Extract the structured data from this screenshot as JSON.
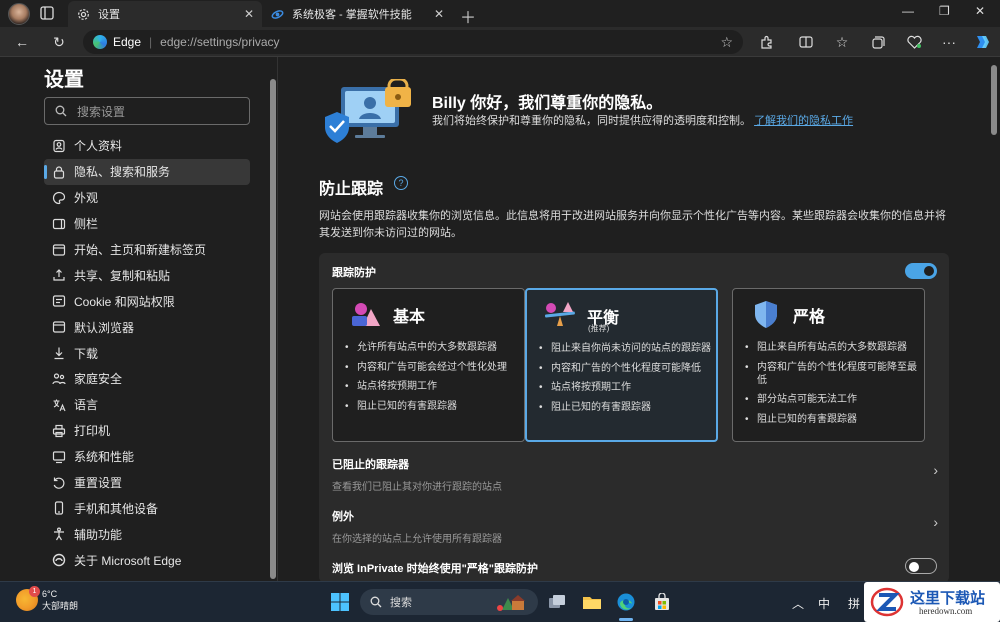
{
  "browser": {
    "tabs": [
      {
        "title": "设置",
        "icon": "gear-icon"
      },
      {
        "title": "系统极客 - 掌握软件技能",
        "icon": "site-favicon-icon"
      }
    ],
    "address": {
      "site_label": "Edge",
      "url": "edge://settings/privacy"
    }
  },
  "sidebar": {
    "title": "设置",
    "search_placeholder": "搜索设置",
    "items": [
      {
        "label": "个人资料",
        "icon": "profile-icon"
      },
      {
        "label": "隐私、搜索和服务",
        "icon": "lock-icon",
        "active": true
      },
      {
        "label": "外观",
        "icon": "appearance-icon"
      },
      {
        "label": "侧栏",
        "icon": "sidebar-icon"
      },
      {
        "label": "开始、主页和新建标签页",
        "icon": "home-icon"
      },
      {
        "label": "共享、复制和粘贴",
        "icon": "share-icon"
      },
      {
        "label": "Cookie 和网站权限",
        "icon": "cookie-icon"
      },
      {
        "label": "默认浏览器",
        "icon": "browser-icon"
      },
      {
        "label": "下载",
        "icon": "download-icon"
      },
      {
        "label": "家庭安全",
        "icon": "family-icon"
      },
      {
        "label": "语言",
        "icon": "language-icon"
      },
      {
        "label": "打印机",
        "icon": "printer-icon"
      },
      {
        "label": "系统和性能",
        "icon": "system-icon"
      },
      {
        "label": "重置设置",
        "icon": "reset-icon"
      },
      {
        "label": "手机和其他设备",
        "icon": "phone-icon"
      },
      {
        "label": "辅助功能",
        "icon": "accessibility-icon"
      },
      {
        "label": "关于 Microsoft Edge",
        "icon": "edge-icon"
      }
    ]
  },
  "main": {
    "hero_title": "Billy 你好，我们尊重你的隐私。",
    "hero_sub": "我们将始终保护和尊重你的隐私，同时提供应得的透明度和控制。",
    "hero_link": "了解我们的隐私工作",
    "section_title": "防止跟踪",
    "section_desc": "网站会使用跟踪器收集你的浏览信息。此信息将用于改进网站服务并向你显示个性化广告等内容。某些跟踪器会收集你的信息并将其发送到你未访问过的网站。",
    "tracking_label": "跟踪防护",
    "tracking_on": true,
    "cards": [
      {
        "title": "基本",
        "subtitle": "",
        "selected": false,
        "items": [
          "允许所有站点中的大多数跟踪器",
          "内容和广告可能会经过个性化处理",
          "站点将按预期工作",
          "阻止已知的有害跟踪器"
        ]
      },
      {
        "title": "平衡",
        "subtitle": "(推荐)",
        "selected": true,
        "items": [
          "阻止来自你尚未访问的站点的跟踪器",
          "内容和广告的个性化程度可能降低",
          "站点将按预期工作",
          "阻止已知的有害跟踪器"
        ]
      },
      {
        "title": "严格",
        "subtitle": "",
        "selected": false,
        "items": [
          "阻止来自所有站点的大多数跟踪器",
          "内容和广告的个性化程度可能降至最低",
          "部分站点可能无法工作",
          "阻止已知的有害跟踪器"
        ]
      }
    ],
    "blocked_title": "已阻止的跟踪器",
    "blocked_sub": "查看我们已阻止其对你进行跟踪的站点",
    "exceptions_title": "例外",
    "exceptions_sub": "在你选择的站点上允许使用所有跟踪器",
    "inprivate_label": "浏览 InPrivate 时始终使用\"严格\"跟踪防护",
    "inprivate_on": false
  },
  "taskbar": {
    "weather_temp": "6°C",
    "weather_desc": "大部晴朗",
    "weather_badge": "1",
    "search_label": "搜索",
    "ime1": "中",
    "ime2": "拼"
  },
  "watermark": {
    "line1": "这里下载站",
    "line2": "heredown.com"
  },
  "colors": {
    "accent": "#5aa9e6",
    "toggle_on": "#4aa4e6"
  }
}
